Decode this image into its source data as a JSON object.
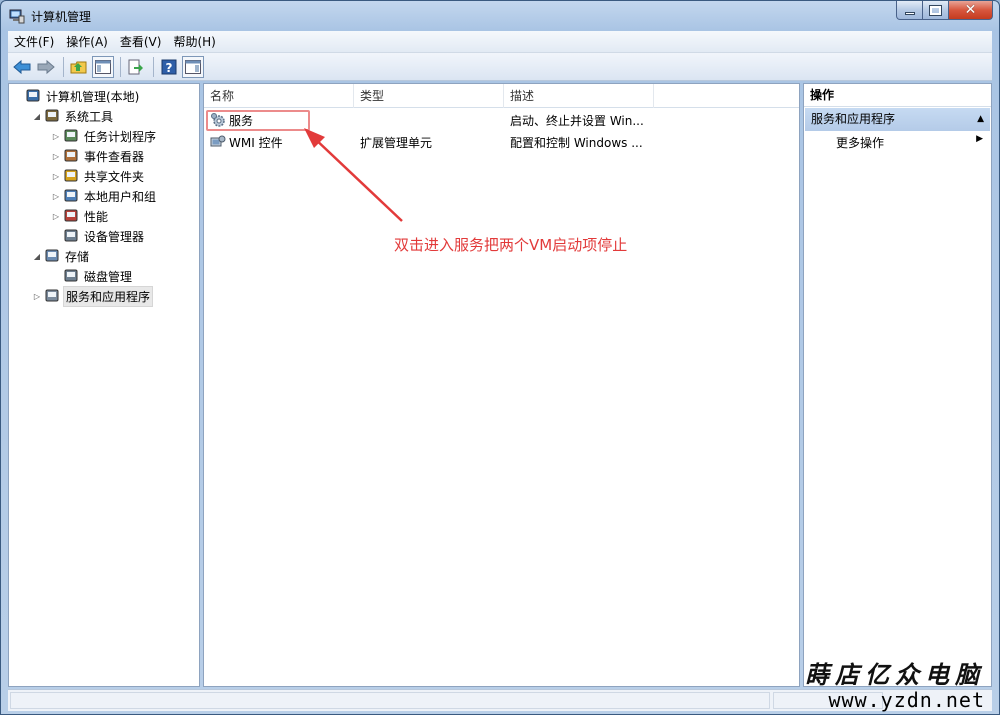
{
  "window": {
    "title": "计算机管理"
  },
  "menu": [
    "文件(F)",
    "操作(A)",
    "查看(V)",
    "帮助(H)"
  ],
  "toolbar": {
    "icons": [
      "back-arrow-icon",
      "forward-arrow-icon",
      "up-folder-icon",
      "show-hide-console-tree-icon",
      "export-list-icon",
      "help-icon",
      "show-hide-action-pane-icon"
    ]
  },
  "tree": [
    {
      "label": "计算机管理(本地)",
      "level": 0,
      "expander": "",
      "icon": "computer-management-icon"
    },
    {
      "label": "系统工具",
      "level": 1,
      "expander": "◢",
      "icon": "system-tools-icon"
    },
    {
      "label": "任务计划程序",
      "level": 2,
      "expander": "▷",
      "icon": "task-scheduler-icon"
    },
    {
      "label": "事件查看器",
      "level": 2,
      "expander": "▷",
      "icon": "event-viewer-icon"
    },
    {
      "label": "共享文件夹",
      "level": 2,
      "expander": "▷",
      "icon": "shared-folders-icon"
    },
    {
      "label": "本地用户和组",
      "level": 2,
      "expander": "▷",
      "icon": "local-users-icon"
    },
    {
      "label": "性能",
      "level": 2,
      "expander": "▷",
      "icon": "performance-icon"
    },
    {
      "label": "设备管理器",
      "level": 2,
      "expander": "",
      "icon": "device-manager-icon"
    },
    {
      "label": "存储",
      "level": 1,
      "expander": "◢",
      "icon": "storage-icon"
    },
    {
      "label": "磁盘管理",
      "level": 2,
      "expander": "",
      "icon": "disk-management-icon"
    },
    {
      "label": "服务和应用程序",
      "level": 1,
      "expander": "▷",
      "icon": "services-apps-icon",
      "selected": true
    }
  ],
  "list": {
    "columns": [
      "名称",
      "类型",
      "描述"
    ],
    "rows": [
      {
        "name": "服务",
        "type": "",
        "description": "启动、终止并设置 Win...",
        "icon": "services-gear-icon"
      },
      {
        "name": "WMI 控件",
        "type": "扩展管理单元",
        "description": "配置和控制 Windows ...",
        "icon": "wmi-control-icon"
      }
    ]
  },
  "annotation": "双击进入服务把两个VM启动项停止",
  "actions": {
    "title": "操作",
    "section": "服务和应用程序",
    "more": "更多操作"
  },
  "watermark": {
    "cn": "蒔店亿众电脑",
    "url": "www.yzdn.net"
  },
  "colors": {
    "annotation": "#e23a3a",
    "selection": "#c6daf2"
  }
}
